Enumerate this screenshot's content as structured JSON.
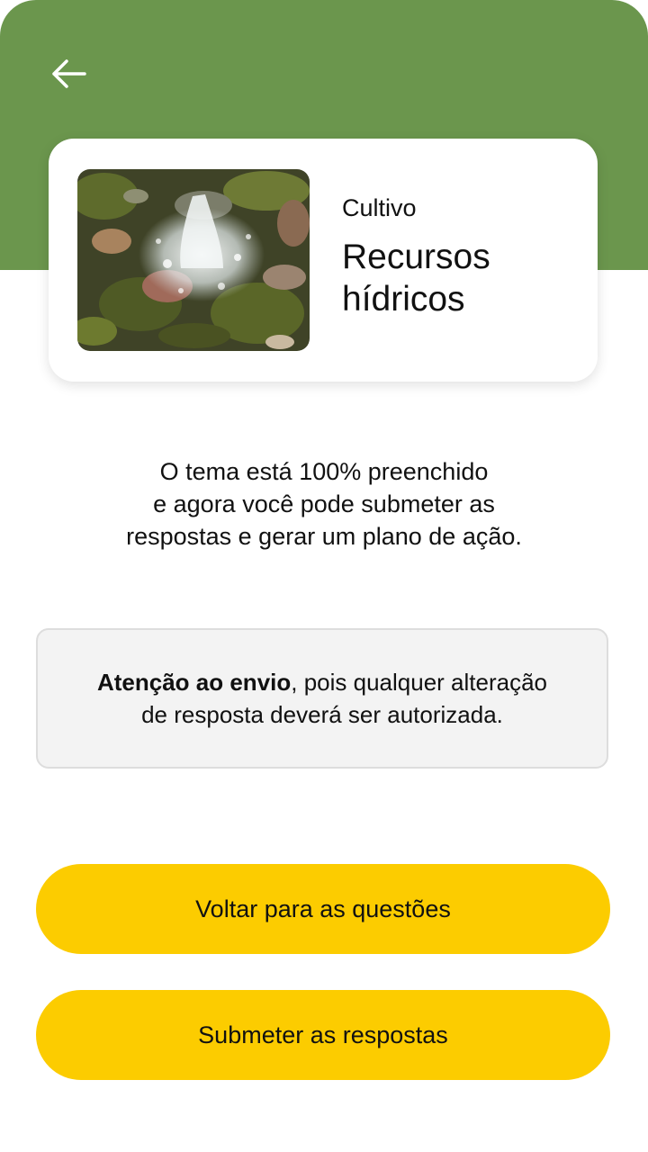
{
  "header": {
    "back_icon": "arrow-left-icon",
    "background_color": "#6b964d"
  },
  "card": {
    "image": "water-fountain-over-stones",
    "category": "Cultivo",
    "title_line1": "Recursos",
    "title_line2": "hídricos"
  },
  "message": {
    "line1": "O tema está 100% preenchido",
    "line2": "e agora você pode submeter as",
    "line3": "respostas e gerar um plano de ação."
  },
  "warning": {
    "bold": "Atenção ao envio",
    "rest_line1": ", pois qualquer alteração",
    "line2": "de resposta deverá ser autorizada."
  },
  "buttons": {
    "back_to_questions": "Voltar para as questões",
    "submit": "Submeter as respostas",
    "color": "#fccc00"
  }
}
